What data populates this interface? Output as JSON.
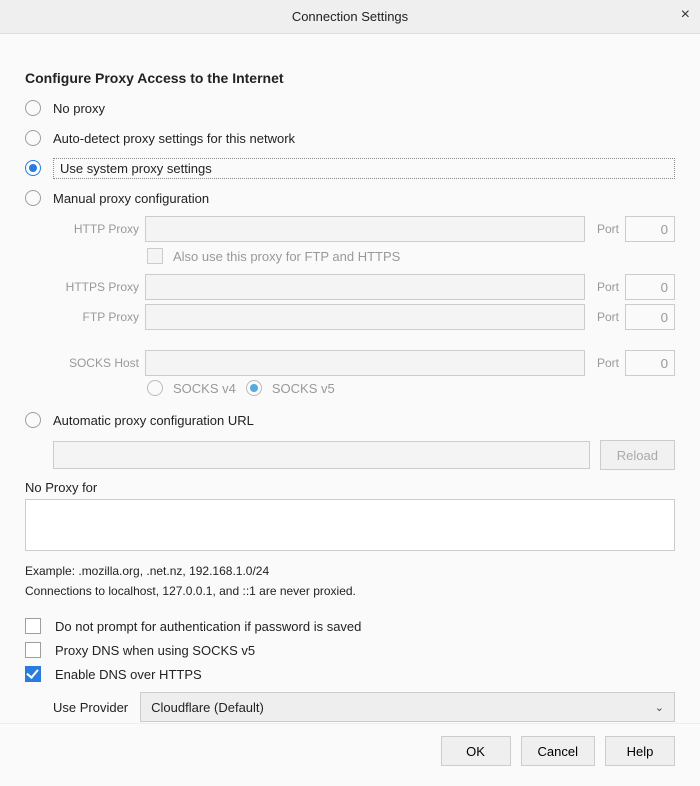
{
  "header": {
    "title": "Connection Settings"
  },
  "section_heading": "Configure Proxy Access to the Internet",
  "radios": {
    "no_proxy": "No proxy",
    "auto_detect": "Auto-detect proxy settings for this network",
    "system": "Use system proxy settings",
    "manual": "Manual proxy configuration",
    "pac": "Automatic proxy configuration URL"
  },
  "proxy": {
    "http_label": "HTTP Proxy",
    "https_label": "HTTPS Proxy",
    "ftp_label": "FTP Proxy",
    "socks_label": "SOCKS Host",
    "port_label": "Port",
    "port_value": "0",
    "also_label": "Also use this proxy for FTP and HTTPS",
    "socks_v4": "SOCKS v4",
    "socks_v5": "SOCKS v5"
  },
  "pac": {
    "reload": "Reload"
  },
  "noproxy": {
    "label": "No Proxy for",
    "example": "Example: .mozilla.org, .net.nz, 192.168.1.0/24",
    "note": "Connections to localhost, 127.0.0.1, and ::1 are never proxied."
  },
  "checks": {
    "no_prompt": "Do not prompt for authentication if password is saved",
    "proxy_dns": "Proxy DNS when using SOCKS v5",
    "doh": "Enable DNS over HTTPS"
  },
  "provider": {
    "label": "Use Provider",
    "value": "Cloudflare (Default)"
  },
  "footer": {
    "ok": "OK",
    "cancel": "Cancel",
    "help": "Help"
  }
}
